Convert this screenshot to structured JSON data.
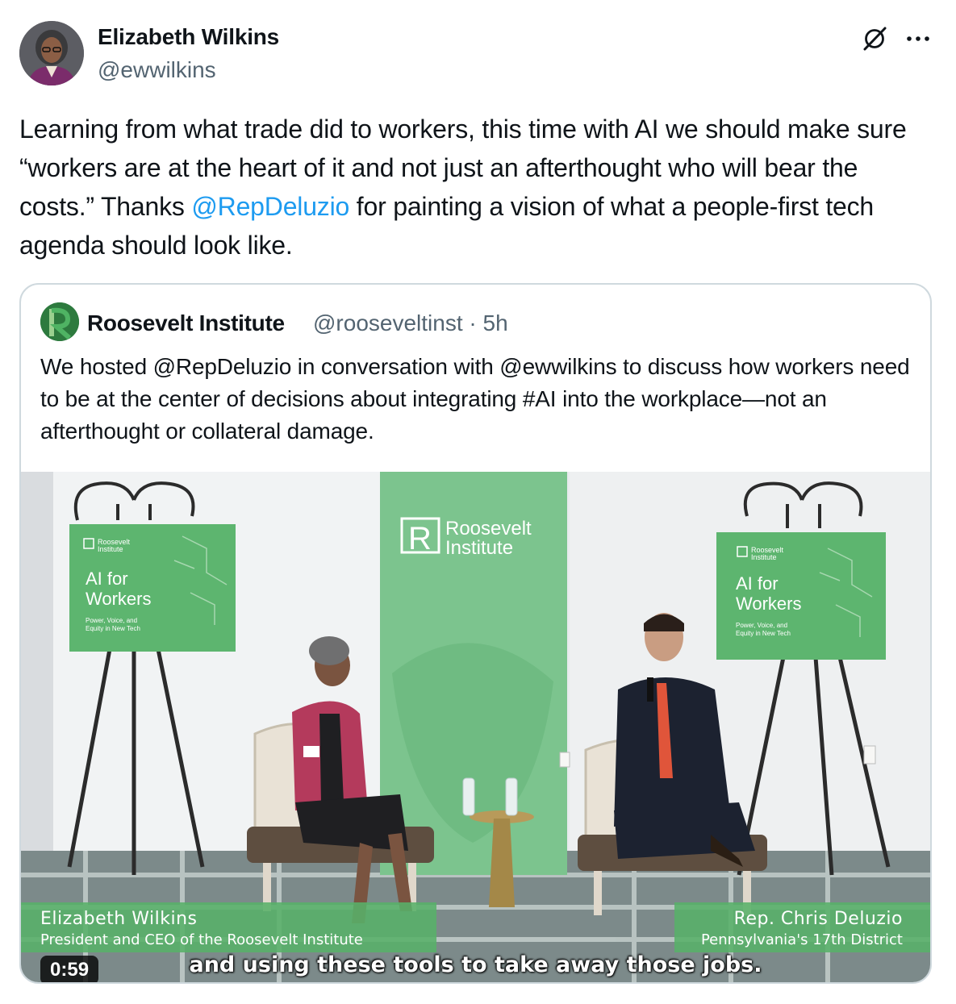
{
  "author": {
    "name": "Elizabeth Wilkins",
    "handle": "@ewwilkins"
  },
  "tweet": {
    "text_part1": "Learning from what trade did to workers, this time with AI we should make sure “workers are at the heart of it and not just an afterthought who will bear the costs.” Thanks ",
    "mention": "@RepDeluzio",
    "text_part2": " for painting a vision of what a people-first tech agenda should look like."
  },
  "quote": {
    "name": "Roosevelt Institute",
    "meta": "@rooseveltinst · 5h",
    "text": "We hosted @RepDeluzio in conversation with @ewwilkins to discuss how workers need to be at the center of decisions about integrating #AI into the workplace—not an afterthought or collateral damage."
  },
  "video": {
    "banner_line1": "Roosevelt",
    "banner_line2": "Institute",
    "sign_brand_line1": "Roosevelt",
    "sign_brand_line2": "Institute",
    "sign_title_line1": "AI for",
    "sign_title_line2": "Workers",
    "sign_sub_line1": "Power, Voice, and",
    "sign_sub_line2": "Equity in New Tech",
    "left_name": "Elizabeth Wilkins",
    "left_title": "President and CEO of the Roosevelt Institute",
    "right_name": "Rep. Chris Deluzio",
    "right_title": "Pennsylvania's 17th District",
    "caption": "and using these tools to take away those jobs.",
    "duration": "0:59"
  },
  "icons": {
    "grok": "grok-icon",
    "more": "more-icon"
  },
  "colors": {
    "mention": "#1d9bf0",
    "secondary_text": "#536471",
    "card_border": "#cfd9de",
    "brand_green": "#58b069"
  }
}
